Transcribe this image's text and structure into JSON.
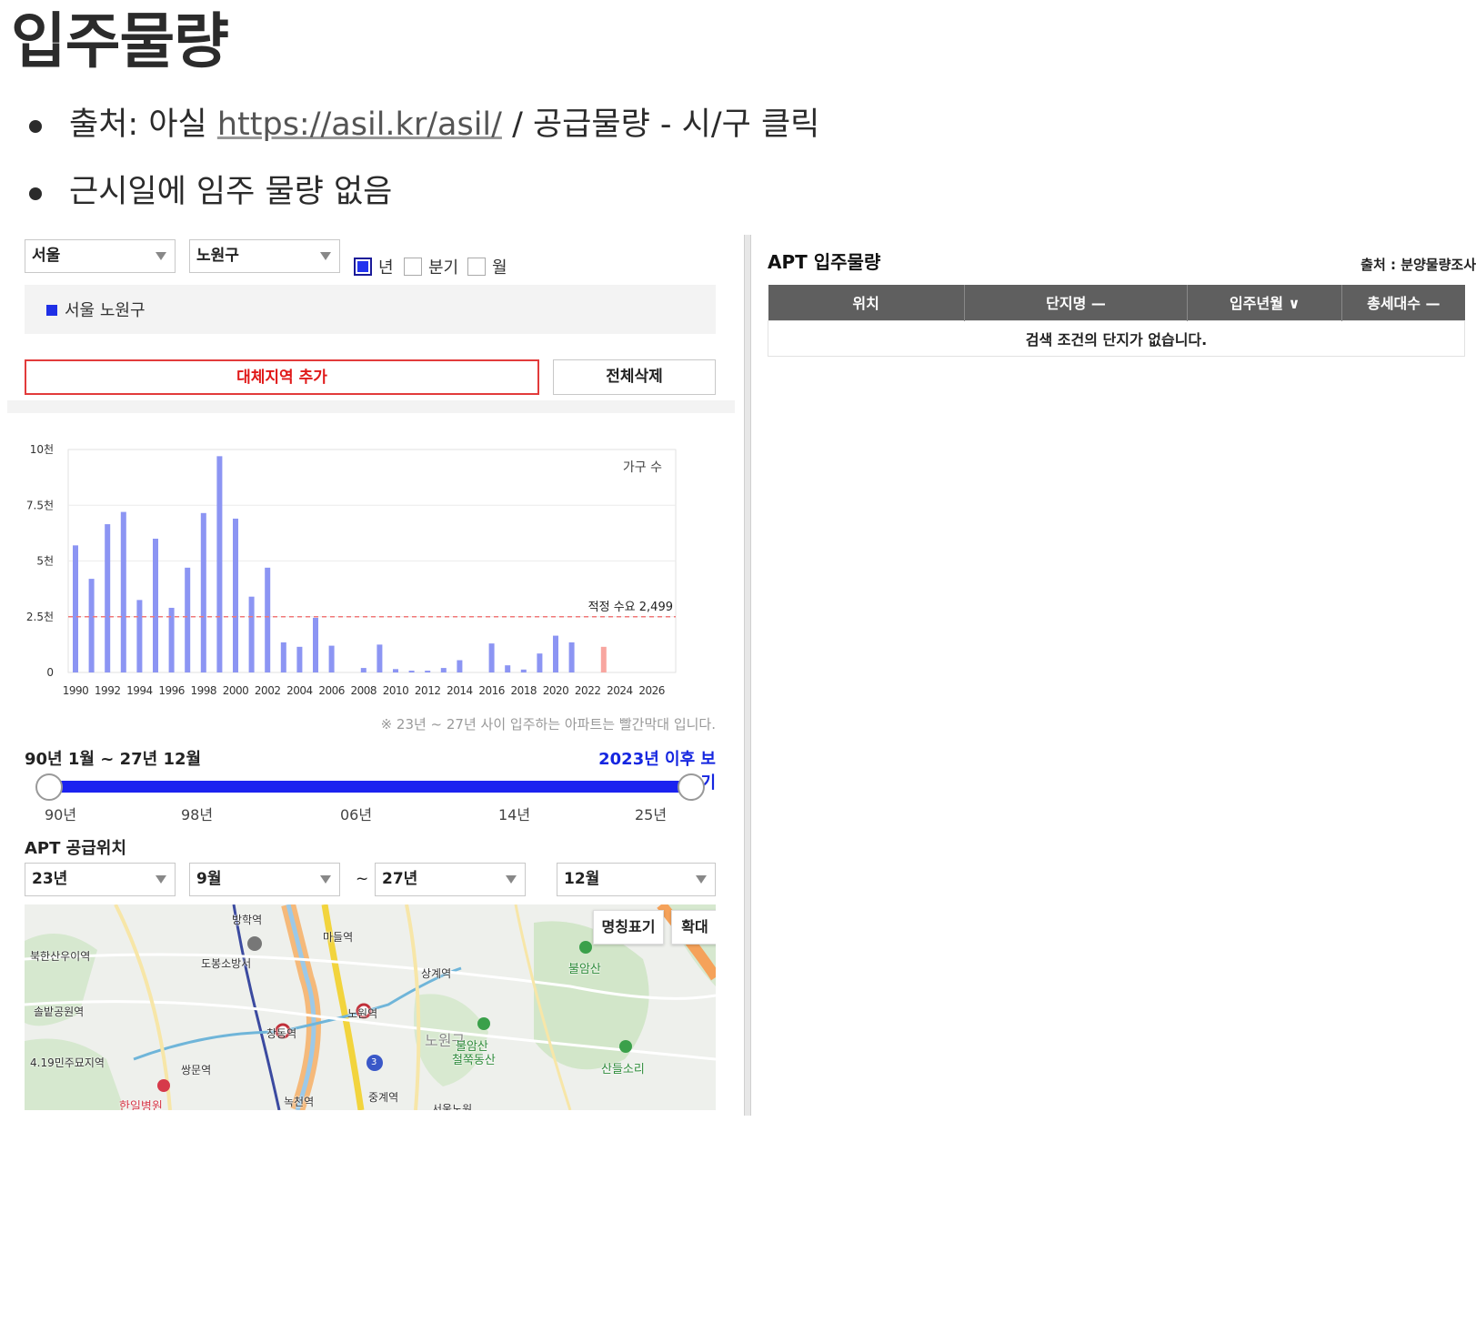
{
  "page": {
    "title": "입주물량",
    "bullets": {
      "source_prefix": "출처: 아실 ",
      "source_link": "https://asil.kr/asil/",
      "source_suffix": " / 공급물량 - 시/구 클릭",
      "note": "근시일에 임주 물량 없음"
    }
  },
  "left": {
    "city_select": "서울",
    "district_select": "노원구",
    "period_options": [
      {
        "label": "년",
        "checked": true
      },
      {
        "label": "분기",
        "checked": false
      },
      {
        "label": "월",
        "checked": false
      }
    ],
    "selected_region": "서울 노원구",
    "add_region_button": "대체지역 추가",
    "delete_all_button": "전체삭제",
    "chart_note": "※ 23년 ~ 27년 사이 입주하는 아파트는 빨간막대 입니다.",
    "range_text": "90년 1월 ~ 27년 12월",
    "range_link": "2023년 이후 보기",
    "slider": {
      "min": 1990,
      "max": 2025,
      "low": 1990,
      "high": 2025,
      "labels": [
        "90년",
        "98년",
        "06년",
        "14년",
        "25년"
      ]
    },
    "supply_title": "APT 공급위치",
    "from_year": "23년",
    "from_month": "9월",
    "tilde": "~",
    "to_year": "27년",
    "to_month": "12월",
    "map": {
      "name_toggle_button": "명칭표기",
      "zoom_button": "확대",
      "labels": [
        "방학역",
        "마들역",
        "북한산우이역",
        "도봉소방서",
        "상계역",
        "불암산",
        "솔밭공원역",
        "노원역",
        "창동역",
        "노원구",
        "불암산",
        "철쭉동산",
        "4.19민주묘지역",
        "쌍문역",
        "산들소리",
        "한일병원",
        "녹천역",
        "중계역",
        "서울노원"
      ],
      "line_badge": "3"
    }
  },
  "chart_data": {
    "type": "bar",
    "title": "",
    "legend": "가구 수",
    "x": [
      1990,
      1991,
      1992,
      1993,
      1994,
      1995,
      1996,
      1997,
      1998,
      1999,
      2000,
      2001,
      2002,
      2003,
      2004,
      2005,
      2006,
      2007,
      2008,
      2009,
      2010,
      2011,
      2012,
      2013,
      2014,
      2015,
      2016,
      2017,
      2018,
      2019,
      2020,
      2021,
      2022,
      2023,
      2024,
      2025,
      2026
    ],
    "values": [
      5700,
      4200,
      6650,
      7200,
      3250,
      6000,
      2900,
      4700,
      7150,
      9700,
      6900,
      3400,
      4700,
      1350,
      1150,
      2450,
      1200,
      0,
      200,
      1250,
      150,
      80,
      80,
      200,
      550,
      0,
      1300,
      320,
      130,
      850,
      1650,
      1350,
      0,
      1150,
      0,
      0,
      0
    ],
    "highlight_from": 2023,
    "bar_color": "#8c95f3",
    "highlight_color": "#f8a6a0",
    "ylim": [
      0,
      10000
    ],
    "y_ticks": [
      0,
      2500,
      5000,
      7500,
      10000
    ],
    "y_tick_labels": [
      "0",
      "2.5천",
      "5천",
      "7.5천",
      "10천"
    ],
    "x_tick_labels": [
      "1990",
      "1992",
      "1994",
      "1996",
      "1998",
      "2000",
      "2002",
      "2004",
      "2006",
      "2008",
      "2010",
      "2012",
      "2014",
      "2016",
      "2018",
      "2020",
      "2022",
      "2024",
      "2026"
    ],
    "reference_line": {
      "value": 2499,
      "label": "적정 수요 2,499",
      "color": "#f07878"
    },
    "grid": true
  },
  "right": {
    "title": "APT 입주물량",
    "source": "출처 : 분양물량조사",
    "columns": [
      "위치",
      "단지명 —",
      "입주년월 ∨",
      "총세대수 —"
    ],
    "empty_message": "검색 조건의 단지가 없습니다."
  }
}
